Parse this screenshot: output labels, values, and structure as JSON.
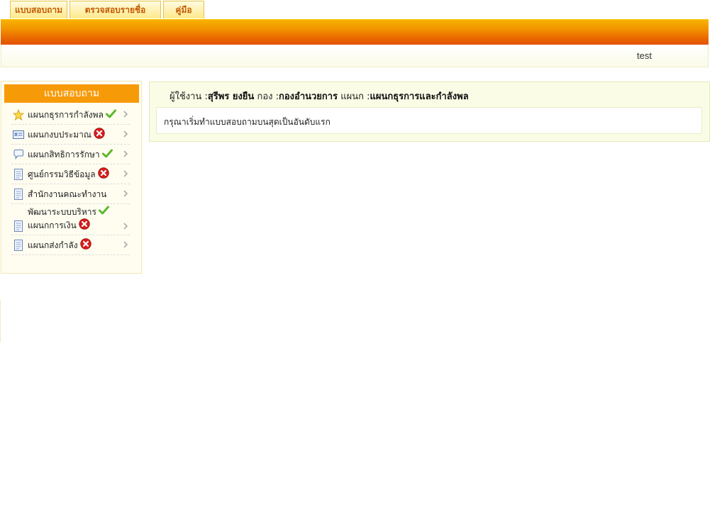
{
  "tabs": [
    {
      "label": "แบบสอบถาม"
    },
    {
      "label": "ตรวจสอบรายชื่อ"
    },
    {
      "label": "คู่มือ"
    }
  ],
  "header": {
    "username": "test"
  },
  "sidebar": {
    "title": "แบบสอบถาม",
    "items": [
      {
        "label": "แผนกธุรการกำลังพล",
        "icon": "star-icon",
        "status": "done"
      },
      {
        "label": "แผนกงบประมาณ",
        "icon": "id-card-icon",
        "status": "not-done"
      },
      {
        "label": "แผนกสิทธิการรักษา",
        "icon": "speech-bubble-icon",
        "status": "done"
      },
      {
        "label": "ศูนย์กรรมวิธีข้อมูล",
        "icon": "document-icon",
        "status": "not-done"
      },
      {
        "label": "สำนักงานคณะทำงาน",
        "icon": "document-icon",
        "status": "none"
      },
      {
        "label_line1": "พัฒนาระบบบริหาร",
        "label_line2": "แผนกการเงิน",
        "icon": "document-icon",
        "status_line1": "done",
        "status_line2": "not-done"
      },
      {
        "label": "แผนกส่งกำลัง",
        "icon": "document-icon",
        "status": "not-done"
      }
    ]
  },
  "main": {
    "user_prefix": "ผู้ใช้งาน :",
    "user_name": "สุรีพร ยงยืน",
    "division_prefix": " กอง :",
    "division": "กองอำนวยการ",
    "section_prefix": " แผนก :",
    "section": "แผนกธุรการและกำลังพล",
    "message": "กรุณาเริ่มทำแบบสอบถามบนสุดเป็นอันดับแรก"
  },
  "colors": {
    "accent_orange": "#f79a08",
    "tab_text": "#c35a00",
    "check_green": "#5cb82a",
    "cross_red": "#d71e1e"
  }
}
